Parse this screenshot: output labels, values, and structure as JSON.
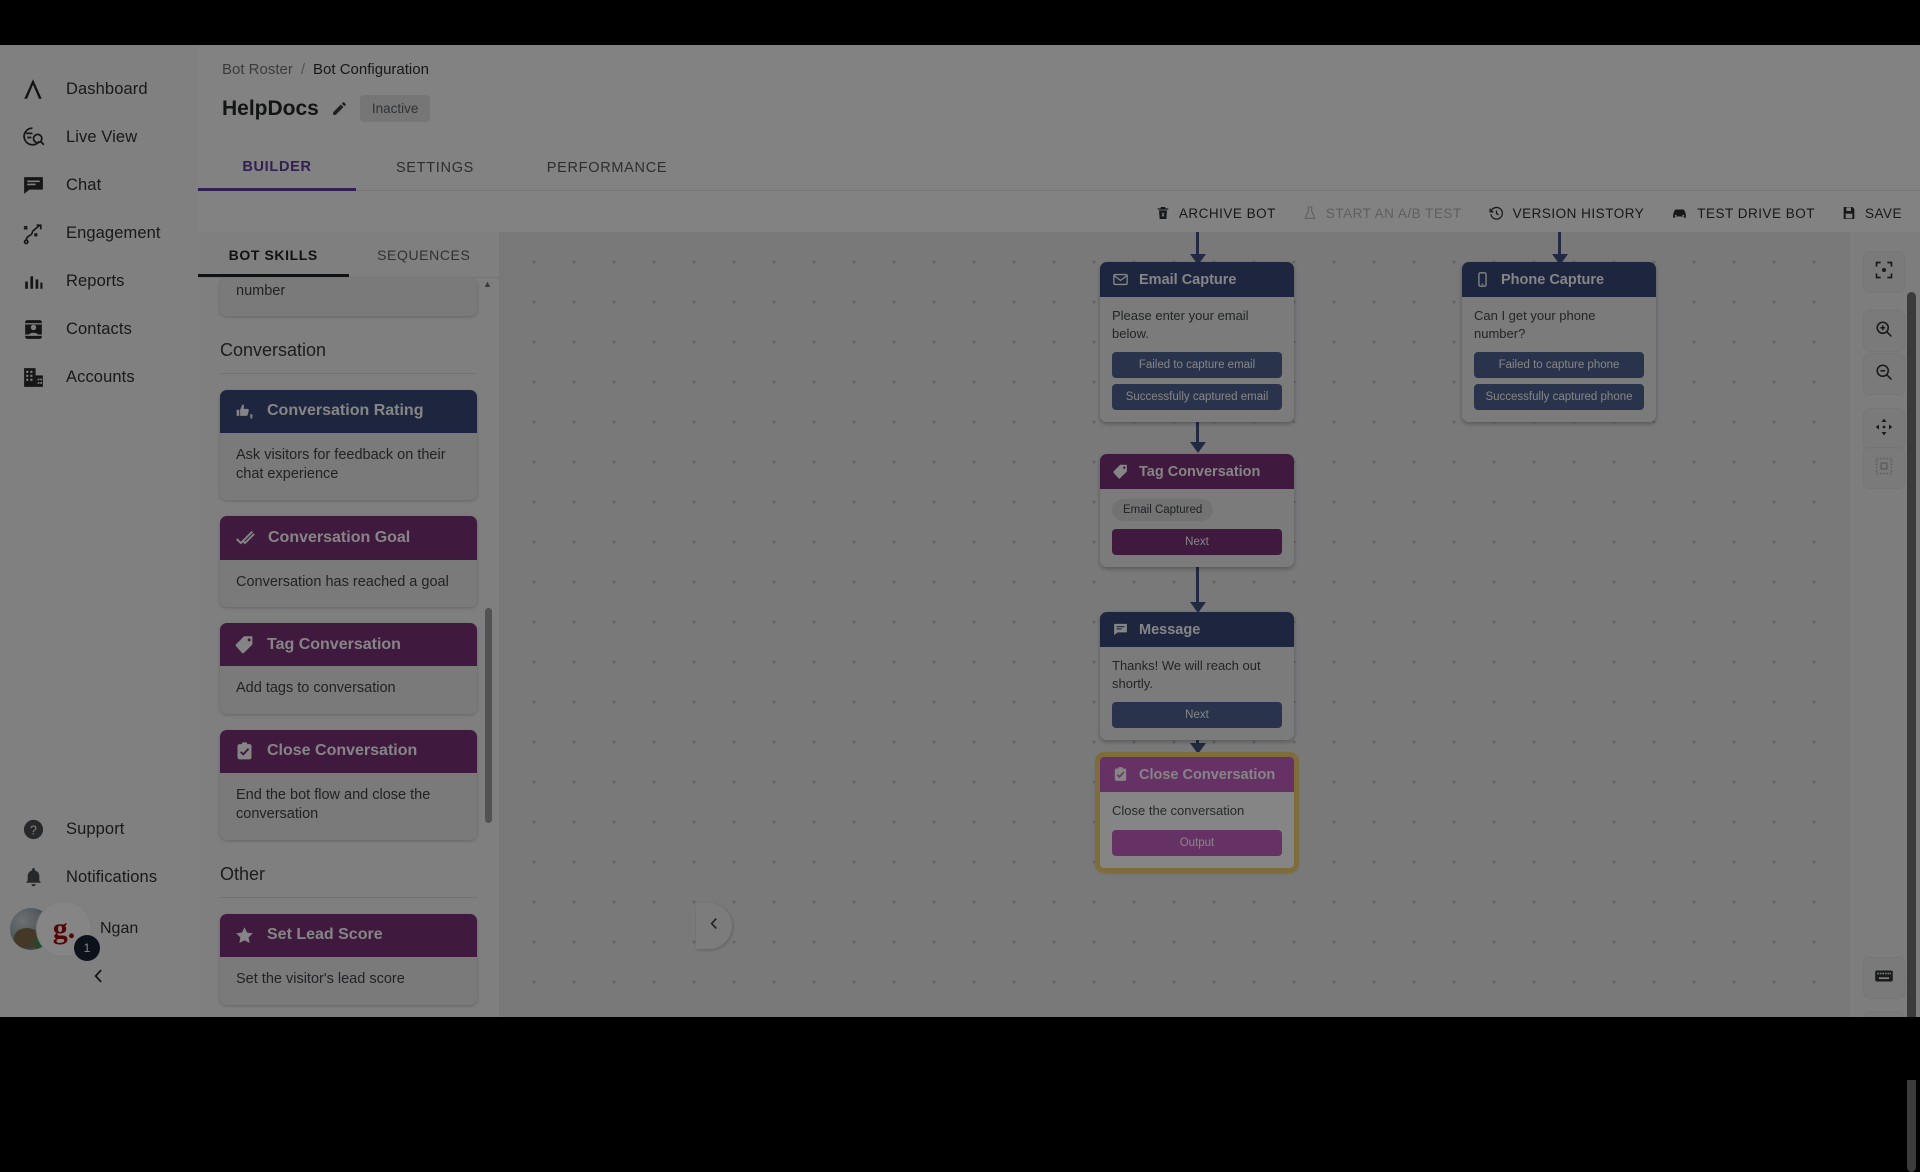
{
  "sidebar": {
    "items": [
      {
        "label": "Dashboard",
        "icon": "logo-a-icon"
      },
      {
        "label": "Live View",
        "icon": "live-view-icon"
      },
      {
        "label": "Chat",
        "icon": "chat-icon"
      },
      {
        "label": "Engagement",
        "icon": "engagement-icon"
      },
      {
        "label": "Reports",
        "icon": "reports-icon"
      },
      {
        "label": "Contacts",
        "icon": "contacts-icon"
      },
      {
        "label": "Accounts",
        "icon": "accounts-icon"
      }
    ],
    "bottom_items": [
      {
        "label": "Support",
        "icon": "help-circle-icon"
      },
      {
        "label": "Notifications",
        "icon": "bell-icon"
      }
    ],
    "profile": {
      "name": "Ngan",
      "logo_text": "g.",
      "badge_count": "1"
    }
  },
  "header": {
    "breadcrumb": {
      "parent": "Bot Roster",
      "separator": "/",
      "current": "Bot Configuration"
    },
    "bot_name": "HelpDocs",
    "status": "Inactive",
    "tabs": [
      {
        "label": "BUILDER",
        "active": true
      },
      {
        "label": "SETTINGS",
        "active": false
      },
      {
        "label": "PERFORMANCE",
        "active": false
      }
    ],
    "accent_color": "#6a34b8"
  },
  "toolbar": {
    "buttons": [
      {
        "label": "ARCHIVE BOT",
        "icon": "trash-icon",
        "disabled": false
      },
      {
        "label": "START AN A/B TEST",
        "icon": "flask-icon",
        "disabled": true
      },
      {
        "label": "VERSION HISTORY",
        "icon": "history-clock-icon",
        "disabled": false
      },
      {
        "label": "TEST DRIVE BOT",
        "icon": "car-icon",
        "disabled": false
      },
      {
        "label": "SAVE",
        "icon": "save-disk-icon",
        "disabled": false
      }
    ]
  },
  "skills_panel": {
    "tabs": [
      {
        "label": "BOT SKILLS",
        "active": true
      },
      {
        "label": "SEQUENCES",
        "active": false
      }
    ],
    "partial_card_text": "number",
    "groups": [
      {
        "label": "Conversation",
        "cards": [
          {
            "title": "Conversation Rating",
            "desc": "Ask visitors for feedback on their chat experience",
            "color": "#33498c",
            "icon": "thumbs-rating-icon"
          },
          {
            "title": "Conversation Goal",
            "desc": "Conversation has reached a goal",
            "color": "#90278e",
            "icon": "check-flag-icon"
          },
          {
            "title": "Tag Conversation",
            "desc": "Add tags to conversation",
            "color": "#90278e",
            "icon": "tag-icon"
          },
          {
            "title": "Close Conversation",
            "desc": "End the bot flow and close the conversation",
            "color": "#90278e",
            "icon": "clipboard-check-icon"
          }
        ]
      },
      {
        "label": "Other",
        "cards": [
          {
            "title": "Set Lead Score",
            "desc": "Set the visitor's lead score",
            "color": "#90278e",
            "icon": "star-icon"
          }
        ]
      }
    ]
  },
  "canvas": {
    "nodes": [
      {
        "id": "email-capture",
        "title": "Email Capture",
        "icon": "envelope-icon",
        "theme": "blue",
        "text": "Please enter your email below.",
        "buttons": [
          "Failed to capture email",
          "Successfully captured email"
        ]
      },
      {
        "id": "phone-capture",
        "title": "Phone Capture",
        "icon": "phone-icon",
        "theme": "blue",
        "text": "Can I get your phone number?",
        "buttons": [
          "Failed to capture phone",
          "Successfully captured phone"
        ]
      },
      {
        "id": "tag-conversation",
        "title": "Tag Conversation",
        "icon": "tag-icon",
        "theme": "purple",
        "chip": "Email Captured",
        "buttons": [
          "Next"
        ]
      },
      {
        "id": "message",
        "title": "Message",
        "icon": "chat-icon",
        "theme": "blue",
        "text": "Thanks! We will reach out shortly.",
        "buttons": [
          "Next"
        ]
      },
      {
        "id": "close-conversation",
        "title": "Close Conversation",
        "icon": "clipboard-check-icon",
        "theme": "selected",
        "text": "Close the conversation",
        "buttons": [
          "Output"
        ],
        "selected": true,
        "highlight_color": "#ffd24a"
      }
    ],
    "tools": [
      {
        "name": "focus-target-icon"
      },
      {
        "name": "zoom-in-icon"
      },
      {
        "name": "zoom-out-icon"
      },
      {
        "name": "pan-move-icon"
      },
      {
        "name": "minimap-icon"
      },
      {
        "name": "keyboard-shortcuts-icon"
      },
      {
        "name": "fullscreen-icon"
      }
    ],
    "collapse_button": "chevron-left-icon"
  }
}
